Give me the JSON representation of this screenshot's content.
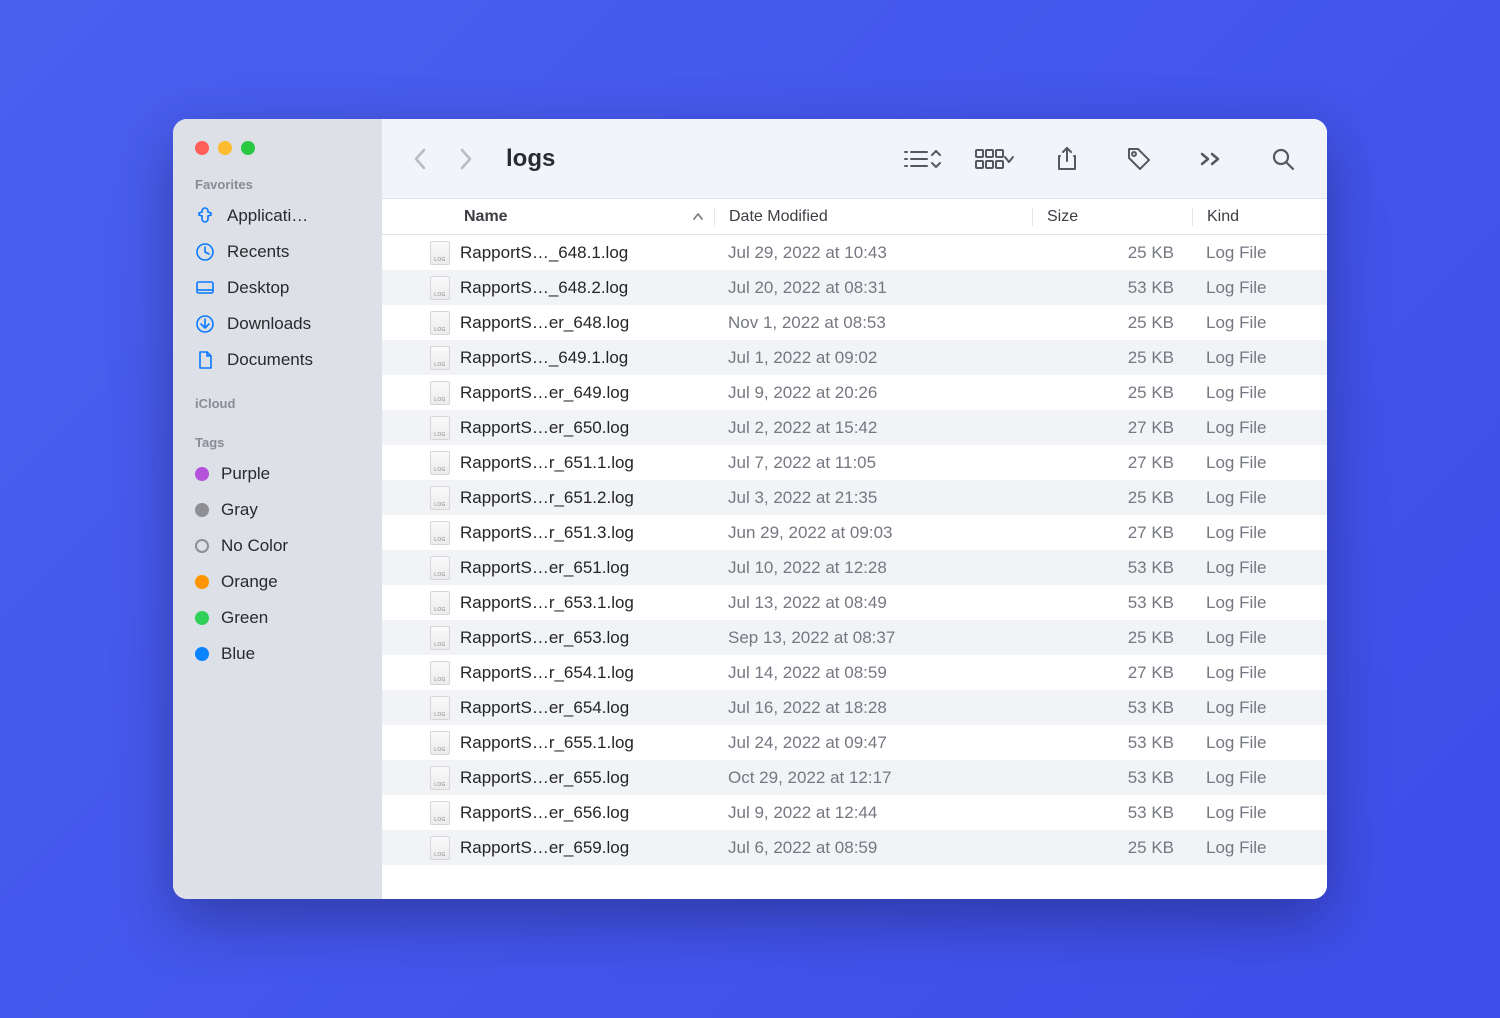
{
  "window_title": "logs",
  "sidebar": {
    "sections": {
      "favorites_label": "Favorites",
      "icloud_label": "iCloud",
      "tags_label": "Tags"
    },
    "favorites": [
      {
        "label": "Applicati…",
        "icon": "app"
      },
      {
        "label": "Recents",
        "icon": "clock"
      },
      {
        "label": "Desktop",
        "icon": "desktop"
      },
      {
        "label": "Downloads",
        "icon": "download"
      },
      {
        "label": "Documents",
        "icon": "doc"
      }
    ],
    "tags": [
      {
        "label": "Purple",
        "color": "purple"
      },
      {
        "label": "Gray",
        "color": "gray"
      },
      {
        "label": "No Color",
        "color": "nocolor"
      },
      {
        "label": "Orange",
        "color": "orange"
      },
      {
        "label": "Green",
        "color": "green"
      },
      {
        "label": "Blue",
        "color": "blue"
      }
    ]
  },
  "columns": {
    "name": "Name",
    "date": "Date Modified",
    "size": "Size",
    "kind": "Kind"
  },
  "files": [
    {
      "name": "RapportS…_648.1.log",
      "date": "Jul 29, 2022 at 10:43",
      "size": "25 KB",
      "kind": "Log File"
    },
    {
      "name": "RapportS…_648.2.log",
      "date": "Jul 20, 2022 at 08:31",
      "size": "53 KB",
      "kind": "Log File"
    },
    {
      "name": "RapportS…er_648.log",
      "date": "Nov 1, 2022 at 08:53",
      "size": "25 KB",
      "kind": "Log File"
    },
    {
      "name": "RapportS…_649.1.log",
      "date": "Jul 1, 2022 at 09:02",
      "size": "25 KB",
      "kind": "Log File"
    },
    {
      "name": "RapportS…er_649.log",
      "date": "Jul 9, 2022 at 20:26",
      "size": "25 KB",
      "kind": "Log File"
    },
    {
      "name": "RapportS…er_650.log",
      "date": "Jul 2, 2022 at 15:42",
      "size": "27 KB",
      "kind": "Log File"
    },
    {
      "name": "RapportS…r_651.1.log",
      "date": "Jul 7, 2022 at 11:05",
      "size": "27 KB",
      "kind": "Log File"
    },
    {
      "name": "RapportS…r_651.2.log",
      "date": "Jul 3, 2022 at 21:35",
      "size": "25 KB",
      "kind": "Log File"
    },
    {
      "name": "RapportS…r_651.3.log",
      "date": "Jun 29, 2022 at 09:03",
      "size": "27 KB",
      "kind": "Log File"
    },
    {
      "name": "RapportS…er_651.log",
      "date": "Jul 10, 2022 at 12:28",
      "size": "53 KB",
      "kind": "Log File"
    },
    {
      "name": "RapportS…r_653.1.log",
      "date": "Jul 13, 2022 at 08:49",
      "size": "53 KB",
      "kind": "Log File"
    },
    {
      "name": "RapportS…er_653.log",
      "date": "Sep 13, 2022 at 08:37",
      "size": "25 KB",
      "kind": "Log File"
    },
    {
      "name": "RapportS…r_654.1.log",
      "date": "Jul 14, 2022 at 08:59",
      "size": "27 KB",
      "kind": "Log File"
    },
    {
      "name": "RapportS…er_654.log",
      "date": "Jul 16, 2022 at 18:28",
      "size": "53 KB",
      "kind": "Log File"
    },
    {
      "name": "RapportS…r_655.1.log",
      "date": "Jul 24, 2022 at 09:47",
      "size": "53 KB",
      "kind": "Log File"
    },
    {
      "name": "RapportS…er_655.log",
      "date": "Oct 29, 2022 at 12:17",
      "size": "53 KB",
      "kind": "Log File"
    },
    {
      "name": "RapportS…er_656.log",
      "date": "Jul 9, 2022 at 12:44",
      "size": "53 KB",
      "kind": "Log File"
    },
    {
      "name": "RapportS…er_659.log",
      "date": "Jul 6, 2022 at 08:59",
      "size": "25 KB",
      "kind": "Log File"
    }
  ]
}
